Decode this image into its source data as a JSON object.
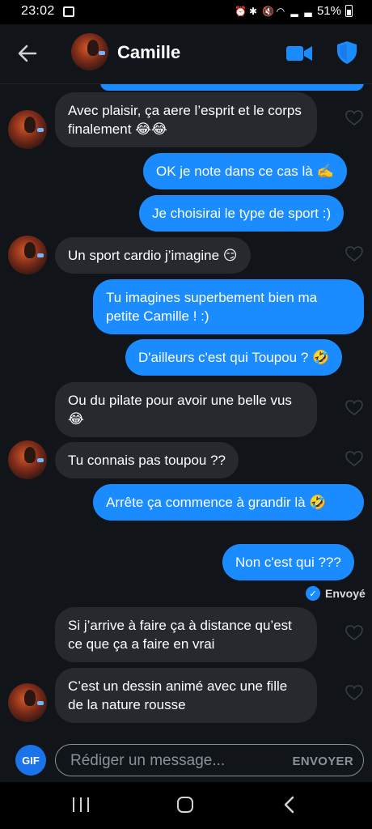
{
  "status_bar": {
    "time": "23:02",
    "battery": "51%"
  },
  "header": {
    "contact_name": "Camille"
  },
  "messages": [
    {
      "id": "m1",
      "direction": "in",
      "text": "Avec plaisir, ça aere l’esprit et le corps finalement 😂😂",
      "avatar": true
    },
    {
      "id": "m2",
      "direction": "out",
      "text": "OK je note dans ce cas là ✍️"
    },
    {
      "id": "m3",
      "direction": "out",
      "text": "Je choisirai le type de sport :)"
    },
    {
      "id": "m4",
      "direction": "in",
      "text": "Un sport cardio j’imagine 😏",
      "avatar": true
    },
    {
      "id": "m5",
      "direction": "out",
      "text": "Tu imagines superbement bien ma petite Camille ! :)"
    },
    {
      "id": "m6",
      "direction": "out",
      "text": "D'ailleurs c'est qui Toupou ? 🤣"
    },
    {
      "id": "m7",
      "direction": "in",
      "text": "Ou du pilate pour avoir une belle vus 😂",
      "avatar": false
    },
    {
      "id": "m8",
      "direction": "in",
      "text": "Tu connais pas toupou ??",
      "avatar": true
    },
    {
      "id": "m9",
      "direction": "out",
      "text": "Arrête ça commence à grandir là 🤣"
    },
    {
      "id": "m10",
      "direction": "out",
      "text": "Non c'est qui ???"
    },
    {
      "id": "m11",
      "direction": "in",
      "text": "Si j’arrive à faire ça à distance qu’est ce que ça a faire en vrai",
      "avatar": false
    },
    {
      "id": "m12",
      "direction": "in",
      "text": "C’est un dessin animé avec une fille de la nature rousse",
      "avatar": true
    }
  ],
  "sent_status": "Envoyé",
  "composer": {
    "gif_label": "GIF",
    "placeholder": "Rédiger un message...",
    "send_label": "ENVOYER"
  },
  "colors": {
    "background": "#111418",
    "incoming_bubble": "#26292e",
    "outgoing_bubble": "#1a8cff",
    "accent": "#1a8cff"
  }
}
